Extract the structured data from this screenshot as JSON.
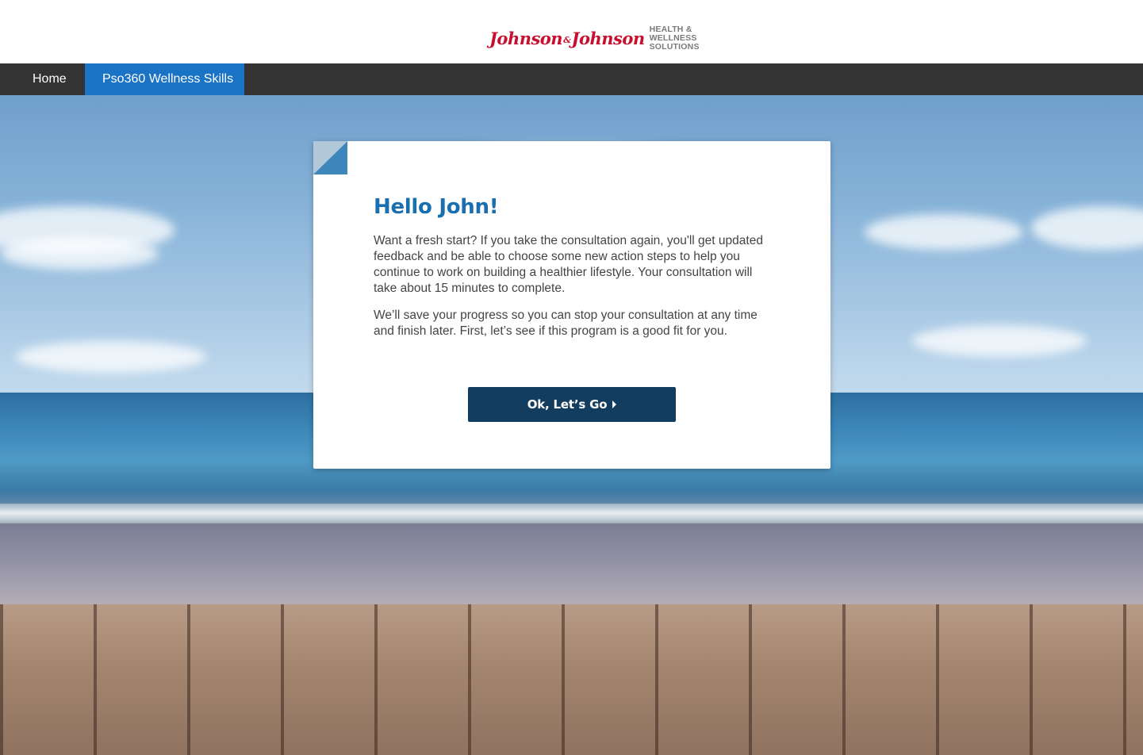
{
  "header": {
    "logo_script": "Johnson & Johnson",
    "logo_tag_lines": [
      "HEALTH &",
      "WELLNESS",
      "SOLUTIONS"
    ]
  },
  "nav": {
    "items": [
      {
        "label": "Home",
        "active": false
      },
      {
        "label": "Pso360 Wellness Skills",
        "active": true
      }
    ]
  },
  "card": {
    "title": "Hello John!",
    "paragraph1": "Want a fresh start? If you take the consultation again, you'll get updated feedback and be able to choose some new action steps to help you continue to work on building a healthier lifestyle. Your consultation will take about 15 minutes to complete.",
    "paragraph2": "We’ll save your progress so you can stop your consultation at any time and finish later. First, let’s see if this program is a good fit for you.",
    "cta_label": "Ok, Let’s Go"
  },
  "colors": {
    "nav_bg": "#333333",
    "nav_active_bg": "#1a73c4",
    "title_color": "#1a6fb0",
    "cta_bg": "#133d5e",
    "logo_red": "#c8102e"
  }
}
